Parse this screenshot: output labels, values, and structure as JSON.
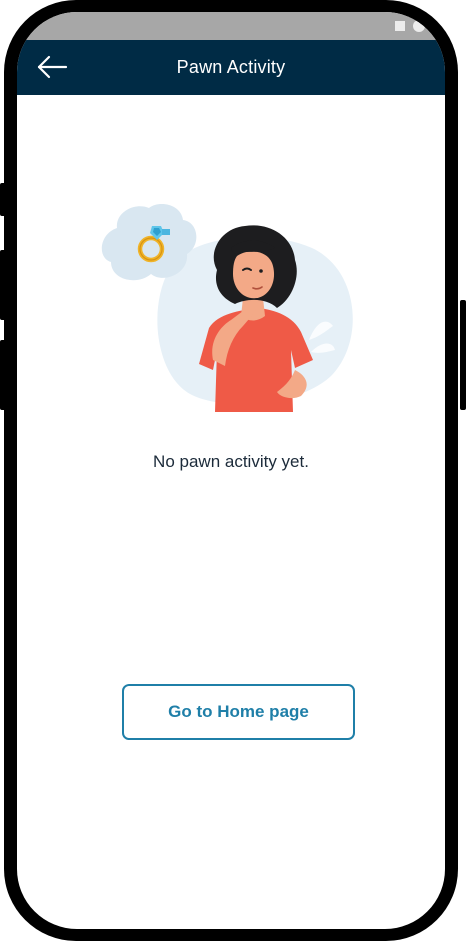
{
  "header": {
    "title": "Pawn Activity",
    "back_icon": "arrow-left-icon"
  },
  "status_bar": {
    "icons": [
      "square-icon",
      "circle-icon"
    ]
  },
  "empty_state": {
    "illustration": "thinking-woman-ring-illustration",
    "message": "No pawn activity yet."
  },
  "actions": {
    "home_button_label": "Go to Home page"
  },
  "colors": {
    "header_bg": "#002b45",
    "accent": "#1f7fa8",
    "status_bar": "#a7a7a7"
  }
}
